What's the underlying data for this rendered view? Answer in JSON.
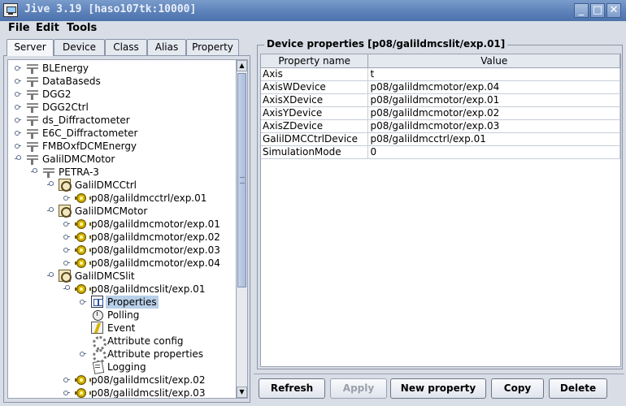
{
  "window": {
    "title": "Jive 3.19  [haso107tk:10000]",
    "min": "_",
    "max": "□",
    "close": "✕"
  },
  "menu": {
    "file": "File",
    "edit": "Edit",
    "tools": "Tools"
  },
  "tabs": [
    "Server",
    "Device",
    "Class",
    "Alias",
    "Property"
  ],
  "tree": {
    "servers": [
      "BLEnergy",
      "DataBaseds",
      "DGG2",
      "DGG2Ctrl",
      "ds_Diffractometer",
      "E6C_Diffractometer",
      "FMBOxfDCMEnergy",
      "GalilDMCMotor"
    ],
    "instance": "PETRA-3",
    "ctrl_class": "GalilDMCCtrl",
    "ctrl_device": "p08/galildmcctrl/exp.01",
    "motor_class": "GalilDMCMotor",
    "motor_devices": [
      "p08/galildmcmotor/exp.01",
      "p08/galildmcmotor/exp.02",
      "p08/galildmcmotor/exp.03",
      "p08/galildmcmotor/exp.04"
    ],
    "slit_class": "GalilDMCSlit",
    "slit_device": "p08/galildmcslit/exp.01",
    "device_children": [
      "Properties",
      "Polling",
      "Event",
      "Attribute config",
      "Attribute properties",
      "Logging"
    ],
    "more_devices": [
      "p08/galildmcslit/exp.02",
      "p08/galildmcslit/exp.03"
    ]
  },
  "properties": {
    "title": "Device properties [p08/galildmcslit/exp.01]",
    "columns": [
      "Property name",
      "Value"
    ],
    "rows": [
      [
        "Axis",
        "t"
      ],
      [
        "AxisWDevice",
        "p08/galildmcmotor/exp.04"
      ],
      [
        "AxisXDevice",
        "p08/galildmcmotor/exp.01"
      ],
      [
        "AxisYDevice",
        "p08/galildmcmotor/exp.02"
      ],
      [
        "AxisZDevice",
        "p08/galildmcmotor/exp.03"
      ],
      [
        "GalilDMCCtrlDevice",
        "p08/galildmcctrl/exp.01"
      ],
      [
        "SimulationMode",
        "0"
      ]
    ]
  },
  "buttons": {
    "refresh": "Refresh",
    "apply": "Apply",
    "new_property": "New property",
    "copy": "Copy",
    "delete": "Delete"
  },
  "colors": {
    "titlebar": "#5b80b8",
    "panel": "#d8dde6",
    "selection": "#b8cfe8"
  }
}
